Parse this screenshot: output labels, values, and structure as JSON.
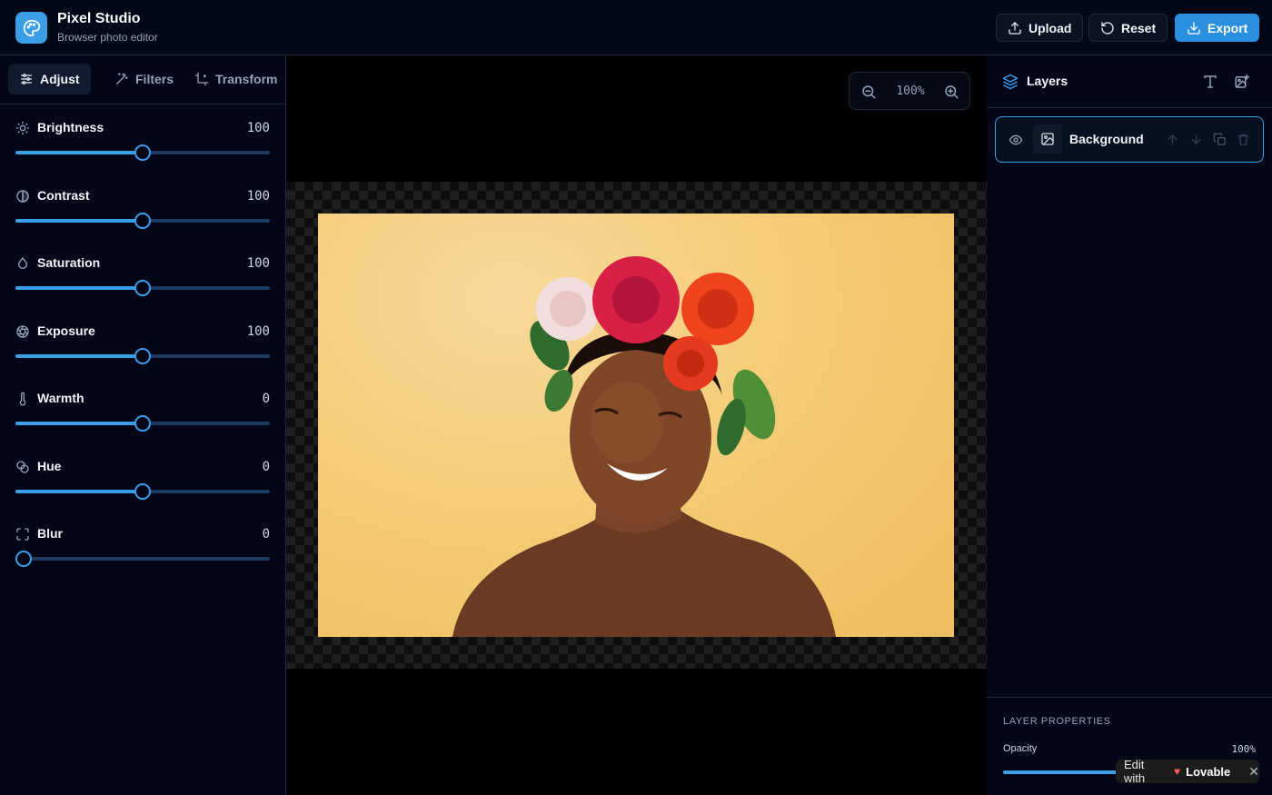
{
  "app": {
    "title": "Pixel Studio",
    "subtitle": "Browser photo editor",
    "accent": "#3b9fe8"
  },
  "header": {
    "upload_label": "Upload",
    "reset_label": "Reset",
    "export_label": "Export"
  },
  "tabs": [
    {
      "label": "Adjust",
      "icon": "sliders-icon",
      "active": true
    },
    {
      "label": "Filters",
      "icon": "wand-icon",
      "active": false
    },
    {
      "label": "Transform",
      "icon": "crop-icon",
      "active": false
    }
  ],
  "adjustments": [
    {
      "label": "Brightness",
      "value": "100",
      "icon": "sun-icon",
      "fraction": 0.5
    },
    {
      "label": "Contrast",
      "value": "100",
      "icon": "contrast-icon",
      "fraction": 0.5
    },
    {
      "label": "Saturation",
      "value": "100",
      "icon": "droplet-icon",
      "fraction": 0.5
    },
    {
      "label": "Exposure",
      "value": "100",
      "icon": "aperture-icon",
      "fraction": 0.5
    },
    {
      "label": "Warmth",
      "value": "0",
      "icon": "thermometer-icon",
      "fraction": 0.5
    },
    {
      "label": "Hue",
      "value": "0",
      "icon": "palette-icon",
      "fraction": 0.5
    },
    {
      "label": "Blur",
      "value": "0",
      "icon": "focus-icon",
      "fraction": 0.0
    }
  ],
  "canvas": {
    "zoom": "100%"
  },
  "layers": {
    "title": "Layers",
    "items": [
      {
        "name": "Background",
        "visible": true
      }
    ]
  },
  "properties": {
    "title": "LAYER PROPERTIES",
    "opacity_label": "Opacity",
    "opacity_value": "100%"
  },
  "badge": {
    "prefix": "Edit with",
    "brand": "Lovable"
  }
}
